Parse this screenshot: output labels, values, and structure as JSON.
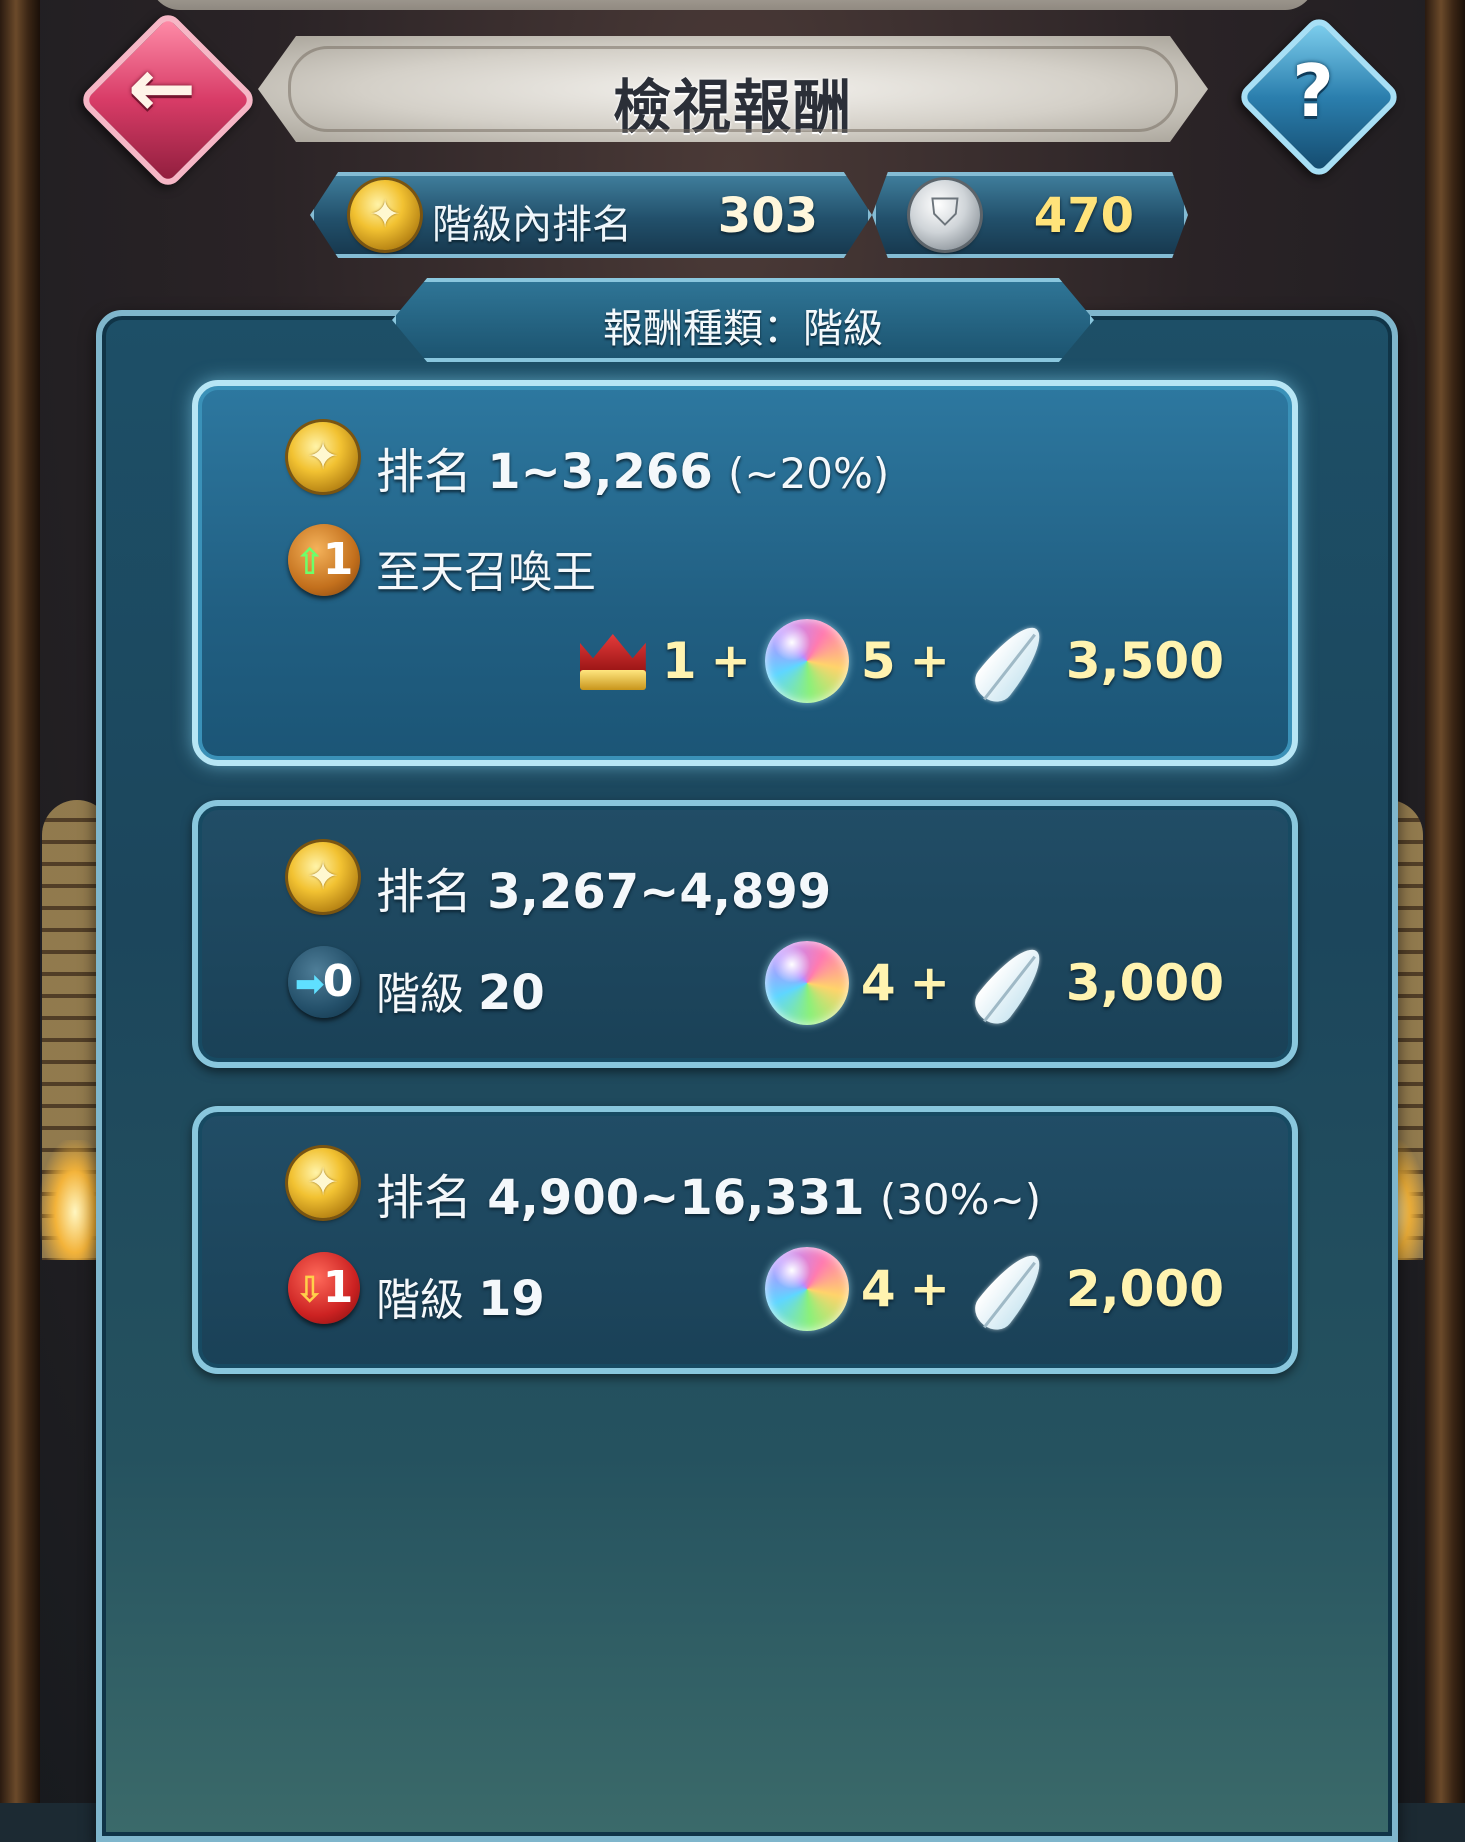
{
  "header": {
    "title": "檢視報酬",
    "back_icon": "←",
    "help_icon": "?"
  },
  "stats": {
    "rank_label": "階級內排名",
    "rank_value": "303",
    "score_value": "470"
  },
  "panel": {
    "tab_label": "報酬種類：階級"
  },
  "tiers": [
    {
      "rank_prefix": "排名",
      "rank_range": "1~3,266",
      "rank_pct": "(~20%)",
      "change_glyph": "⇧",
      "change_amount": "1",
      "change_text": "至天召喚王",
      "change_num": "",
      "rewards": {
        "crown": "1",
        "orbs": "5",
        "feathers": "3,500"
      }
    },
    {
      "rank_prefix": "排名",
      "rank_range": "3,267~4,899",
      "rank_pct": "",
      "change_glyph": "➡",
      "change_amount": "0",
      "change_text": "階級",
      "change_num": "20",
      "rewards": {
        "orbs": "4",
        "feathers": "3,000"
      }
    },
    {
      "rank_prefix": "排名",
      "rank_range": "4,900~16,331",
      "rank_pct": "(30%~)",
      "change_glyph": "⇩",
      "change_amount": "1",
      "change_text": "階級",
      "change_num": "19",
      "rewards": {
        "orbs": "4",
        "feathers": "2,000"
      }
    }
  ],
  "plus_sign": "+",
  "icons": {
    "medal": "rank-medal-icon",
    "score": "silver-shield-medal-icon",
    "crown": "crown-icon",
    "orb": "orb-icon",
    "feather": "feather-icon"
  }
}
